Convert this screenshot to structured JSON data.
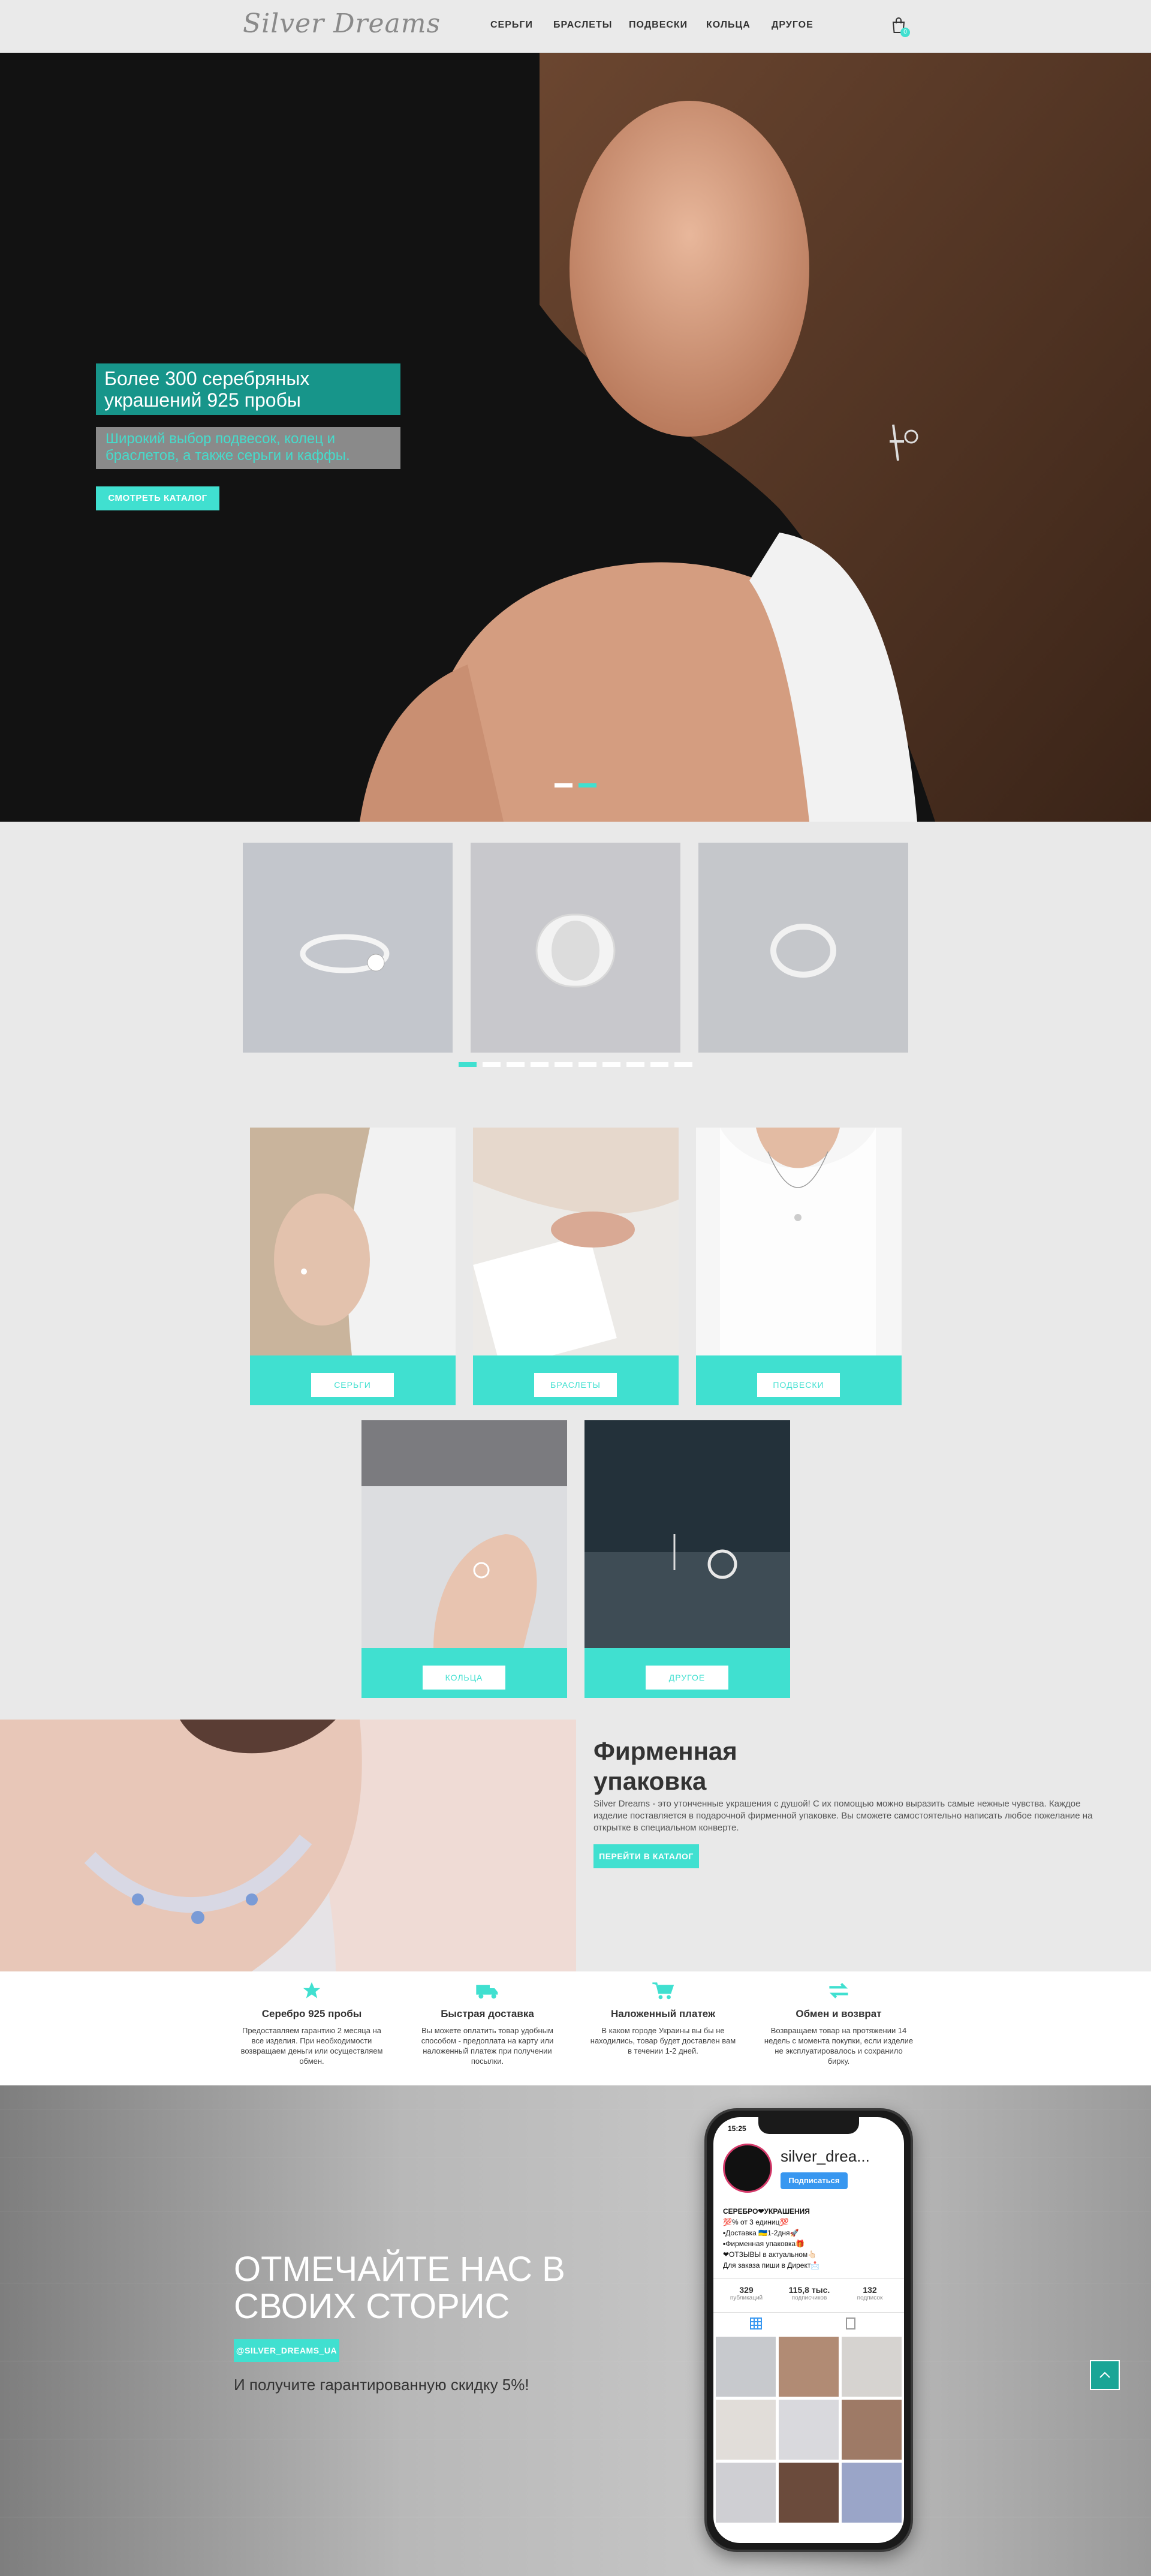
{
  "header": {
    "logo": "Silver Dreams",
    "nav": [
      "СЕРЬГИ",
      "БРАСЛЕТЫ",
      "ПОДВЕСКИ",
      "КОЛЬЦА",
      "ДРУГОЕ"
    ],
    "cart_count": "0",
    "icons": {
      "cart": "shopping-bag-icon"
    }
  },
  "hero": {
    "title": "Более 300 серебряных украшений 925 пробы",
    "subtitle": "Широкий выбор подвесок, колец и браслетов, а также серьги и каффы.",
    "button": "СМОТРЕТЬ КАТАЛОГ",
    "active_slide": 2,
    "slides": 2
  },
  "product_slider": {
    "dots": 10,
    "active_dot": 1
  },
  "categories": [
    {
      "label": "СЕРЬГИ"
    },
    {
      "label": "БРАСЛЕТЫ"
    },
    {
      "label": "ПОДВЕСКИ"
    },
    {
      "label": "КОЛЬЦА"
    },
    {
      "label": "ДРУГОЕ"
    }
  ],
  "packaging": {
    "title": "Фирменная упаковка",
    "text": "Silver Dreams - это утонченные украшения с душой! С их помощью можно выразить самые нежные чувства. Каждое изделие поставляется в подарочной фирменной упаковке. Вы сможете самостоятельно написать любое пожелание на открытке в специальном конверте.",
    "button": "ПЕРЕЙТИ В КАТАЛОГ"
  },
  "features": [
    {
      "icon": "star-icon",
      "title": "Серебро 925 пробы",
      "text": "Предоставляем гарантию 2 месяца на все изделия. При необходимости возвращаем деньги или осуществляем обмен."
    },
    {
      "icon": "truck-icon",
      "title": "Быстрая доставка",
      "text": "Вы можете оплатить товар удобным способом - предоплата на карту или наложенный платеж при получении посылки."
    },
    {
      "icon": "cart-icon",
      "title": "Наложенный платеж",
      "text": "В каком городе Украины вы бы не находились, товар будет доставлен вам в течении 1-2 дней."
    },
    {
      "icon": "exchange-icon",
      "title": "Обмен и возврат",
      "text": "Возвращаем товар на протяжении 14 недель с момента покупки, если изделие не эксплуатировалось и сохранило бирку."
    }
  ],
  "stories": {
    "title": "ОТМЕЧАЙТЕ НАС В СВОИХ СТОРИС",
    "tag": "@SILVER_DREAMS_UA",
    "text": "И получите гарантированную скидку 5%!"
  },
  "instagram": {
    "time": "15:25",
    "username": "silver_drea...",
    "follow": "Подписаться",
    "bio_title": "СЕРЕБРО❤УКРАШЕНИЯ",
    "bio_lines": [
      "💯% от 3 единиц💯",
      "▪Доставка 🇺🇦1-2дня🚀",
      "▪Фирменная упаковка🎁",
      "❤ОТЗЫВЫ в актуальном👆🏻",
      "Для заказа пиши в Директ📩"
    ],
    "stats": [
      {
        "value": "329",
        "label": "публикаций"
      },
      {
        "value": "115,8 тыс.",
        "label": "подписчиков"
      },
      {
        "value": "132",
        "label": "подписок"
      }
    ]
  },
  "colors": {
    "accent": "#40e0d0",
    "dark_teal": "#17958a",
    "text": "#333333"
  }
}
